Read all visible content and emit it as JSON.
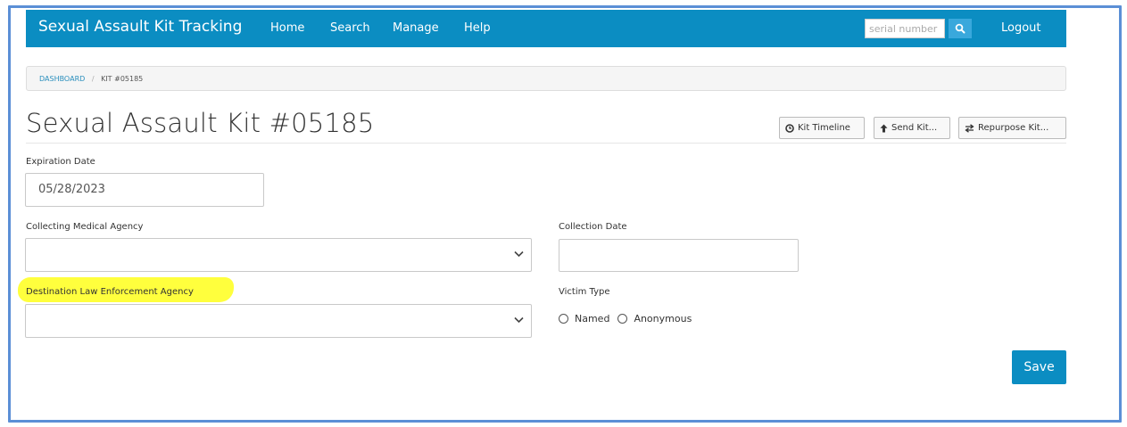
{
  "navbar": {
    "brand": "Sexual Assault Kit Tracking",
    "links": [
      "Home",
      "Search",
      "Manage",
      "Help"
    ],
    "search": {
      "placeholder": "serial number",
      "value": ""
    },
    "search_icon": "search-icon",
    "logout": "Logout"
  },
  "breadcrumb": {
    "root": "DASHBOARD",
    "separator": "/",
    "current": "KIT #05185"
  },
  "page": {
    "title": "Sexual Assault Kit #05185"
  },
  "toolbar": {
    "timeline": "Kit Timeline",
    "send": "Send Kit...",
    "repurpose": "Repurpose Kit..."
  },
  "form": {
    "expiration_label": "Expiration Date",
    "expiration_value": "05/28/2023",
    "collecting_agency_label": "Collecting Medical Agency",
    "collecting_agency_value": "",
    "collection_date_label": "Collection Date",
    "collection_date_value": "",
    "destination_agency_label": "Destination Law Enforcement Agency",
    "destination_agency_value": "",
    "victim_type_label": "Victim Type",
    "victim_options": [
      "Named",
      "Anonymous"
    ]
  },
  "save_label": "Save",
  "colors": {
    "primary": "#0b8dc2",
    "search_button": "#39a8dc",
    "highlight": "#ffff33",
    "frame_border": "#5b8fd6"
  }
}
